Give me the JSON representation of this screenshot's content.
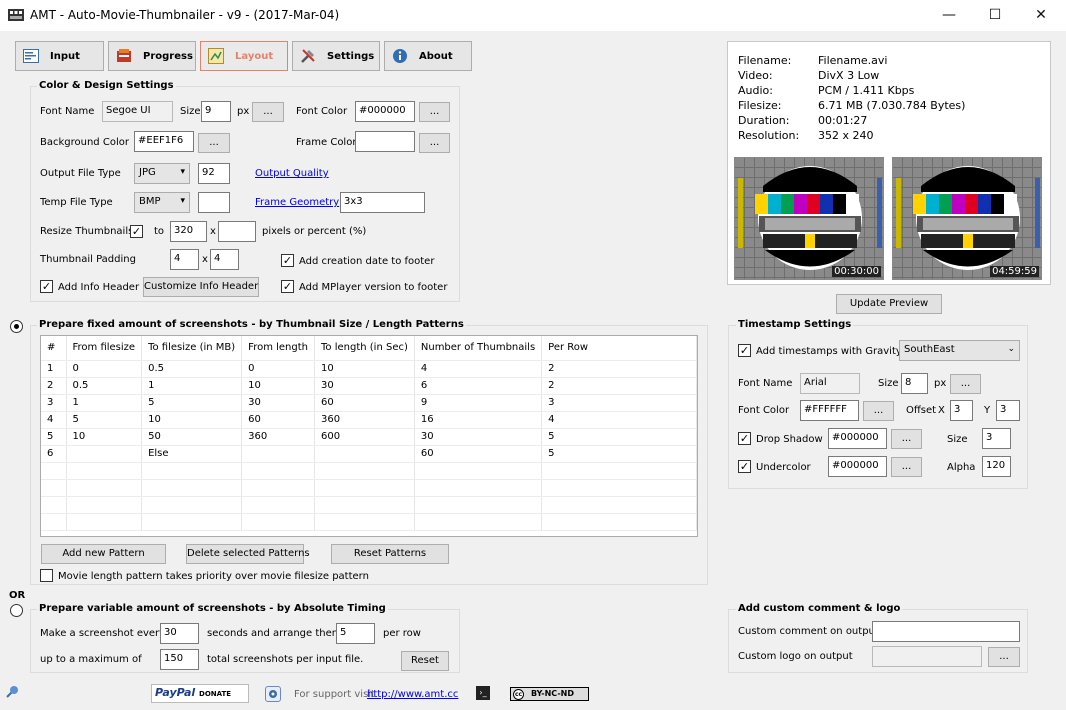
{
  "window": {
    "title": "AMT - Auto-Movie-Thumbnailer - v9 - (2017-Mar-04)",
    "minimize": "—",
    "maximize": "☐",
    "close": "✕"
  },
  "tabs": [
    {
      "label": "Input",
      "icon": "input-icon"
    },
    {
      "label": "Progress",
      "icon": "progress-icon"
    },
    {
      "label": "Layout",
      "icon": "layout-icon"
    },
    {
      "label": "Settings",
      "icon": "settings-icon"
    },
    {
      "label": "About",
      "icon": "info-icon"
    }
  ],
  "active_tab": "Layout",
  "color_design": {
    "title": "Color & Design Settings",
    "font_name_label": "Font Name",
    "font_name": "Segoe UI",
    "size_label": "Size",
    "size": "9",
    "px": "px",
    "ellipsis": "...",
    "font_color_label": "Font Color",
    "font_color": "#000000",
    "bg_color_label": "Background Color",
    "bg_color": "#EEF1F6",
    "frame_color_label": "Frame Color",
    "frame_color": "",
    "output_type_label": "Output File Type",
    "output_type": "JPG",
    "quality": "92",
    "output_quality_link": "Output Quality",
    "temp_type_label": "Temp File Type",
    "temp_type": "BMP",
    "temp_extra": "",
    "frame_geometry_link": "Frame Geometry",
    "frame_geometry": "3x3",
    "resize_label": "Resize Thumbnails",
    "resize_checked": true,
    "to": "to",
    "width": "320",
    "x": "x",
    "height": "",
    "pixels_label": "pixels or percent (%)",
    "padding_label": "Thumbnail Padding",
    "pad_x": "4",
    "pad_y": "4",
    "add_creation_label": "Add creation date to footer",
    "add_creation_checked": true,
    "add_info_label": "Add Info Header",
    "add_info_checked": true,
    "customize_button": "Customize Info Header",
    "add_mplayer_label": "Add MPlayer version to footer",
    "add_mplayer_checked": true
  },
  "fixed": {
    "radio_selected": true,
    "title": "Prepare fixed amount of screenshots - by Thumbnail Size / Length Patterns",
    "columns": [
      "#",
      "From filesize",
      "To filesize (in MB)",
      "From length",
      "To length (in Sec)",
      "Number of Thumbnails",
      "Per Row"
    ],
    "rows": [
      [
        "1",
        "0",
        "0.5",
        "0",
        "10",
        "4",
        "2"
      ],
      [
        "2",
        "0.5",
        "1",
        "10",
        "30",
        "6",
        "2"
      ],
      [
        "3",
        "1",
        "5",
        "30",
        "60",
        "9",
        "3"
      ],
      [
        "4",
        "5",
        "10",
        "60",
        "360",
        "16",
        "4"
      ],
      [
        "5",
        "10",
        "50",
        "360",
        "600",
        "30",
        "5"
      ],
      [
        "6",
        "",
        "Else",
        "",
        "",
        "60",
        "5"
      ],
      [
        "",
        "",
        "",
        "",
        "",
        "",
        ""
      ],
      [
        "",
        "",
        "",
        "",
        "",
        "",
        ""
      ],
      [
        "",
        "",
        "",
        "",
        "",
        "",
        ""
      ],
      [
        "",
        "",
        "",
        "",
        "",
        "",
        ""
      ]
    ],
    "add_button": "Add new Pattern",
    "delete_button": "Delete selected Patterns",
    "reset_button": "Reset Patterns",
    "priority_label": "Movie length pattern takes priority over movie filesize pattern",
    "priority_checked": false
  },
  "or_label": "OR",
  "variable": {
    "radio_selected": false,
    "title": "Prepare variable amount of screenshots - by Absolute Timing",
    "make_label": "Make a screenshot every",
    "every": "30",
    "seconds_label": "seconds and arrange them",
    "per_row": "5",
    "per_row_label": "per row",
    "max_label": "up to a maximum of",
    "max": "150",
    "total_label": "total screenshots per input file.",
    "reset_button": "Reset"
  },
  "info": {
    "rows": [
      {
        "k": "Filename:",
        "v": "Filename.avi"
      },
      {
        "k": "Video:",
        "v": "DivX 3 Low"
      },
      {
        "k": "Audio:",
        "v": "PCM / 1.411 Kbps"
      },
      {
        "k": "Filesize:",
        "v": "6.71 MB (7.030.784 Bytes)"
      },
      {
        "k": "Duration:",
        "v": "00:01:27"
      },
      {
        "k": "Resolution:",
        "v": "352 x 240"
      }
    ],
    "thumb1_time": "00:30:00",
    "thumb2_time": "04:59:59"
  },
  "update_preview": "Update Preview",
  "timestamp": {
    "title": "Timestamp Settings",
    "add_label": "Add timestamps with Gravity",
    "add_checked": true,
    "gravity": "SouthEast",
    "font_name_label": "Font Name",
    "font_name": "Arial",
    "size_label": "Size",
    "size": "8",
    "px": "px",
    "font_color_label": "Font Color",
    "font_color": "#FFFFFF",
    "offset_label": "Offset",
    "x_label": "X",
    "offset_x": "3",
    "y_label": "Y",
    "offset_y": "3",
    "drop_shadow_label": "Drop Shadow",
    "drop_shadow_checked": true,
    "shadow_color": "#000000",
    "shadow_size_label": "Size",
    "shadow_size": "3",
    "undercolor_label": "Undercolor",
    "undercolor_checked": true,
    "undercolor": "#000000",
    "alpha_label": "Alpha",
    "alpha": "120"
  },
  "custom": {
    "title": "Add custom comment & logo",
    "comment_label": "Custom comment on output",
    "comment": "",
    "logo_label": "Custom logo on output",
    "logo": ""
  },
  "footer": {
    "paypal": "PayPal",
    "donate": "DONATE",
    "support_text": "For support visit",
    "support_link": "http://www.amt.cc",
    "cc_badge": "BY-NC-ND"
  }
}
